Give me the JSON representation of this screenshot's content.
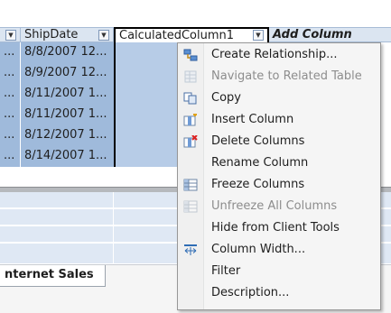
{
  "grid": {
    "headers": {
      "ship_date": "ShipDate",
      "calculated": "CalculatedColumn1",
      "add_column": "Add Column",
      "dropdown_glyph": "▼"
    },
    "left_cell_text": "...",
    "rows": [
      {
        "ship_date": "8/8/2007 12..."
      },
      {
        "ship_date": "8/9/2007 12..."
      },
      {
        "ship_date": "8/11/2007 1..."
      },
      {
        "ship_date": "8/11/2007 1..."
      },
      {
        "ship_date": "8/12/2007 1..."
      },
      {
        "ship_date": "8/14/2007 1..."
      }
    ]
  },
  "sheet_tab": {
    "label": "nternet Sales"
  },
  "context_menu": {
    "items": [
      {
        "label": "Create Relationship...",
        "icon": "relationship-icon",
        "disabled": false
      },
      {
        "label": "Navigate to Related Table",
        "icon": "related-table-icon",
        "disabled": true
      },
      {
        "label": "Copy",
        "icon": "copy-icon",
        "disabled": false
      },
      {
        "label": "Insert Column",
        "icon": "insert-column-icon",
        "disabled": false
      },
      {
        "label": "Delete Columns",
        "icon": "delete-columns-icon",
        "disabled": false
      },
      {
        "label": "Rename Column",
        "icon": "",
        "disabled": false
      },
      {
        "label": "Freeze Columns",
        "icon": "freeze-columns-icon",
        "disabled": false
      },
      {
        "label": "Unfreeze All Columns",
        "icon": "unfreeze-columns-icon",
        "disabled": true
      },
      {
        "label": "Hide from Client Tools",
        "icon": "",
        "disabled": false
      },
      {
        "label": "Column Width...",
        "icon": "column-width-icon",
        "disabled": false
      },
      {
        "label": "Filter",
        "icon": "",
        "disabled": false
      },
      {
        "label": "Description...",
        "icon": "",
        "disabled": false
      }
    ]
  },
  "colors": {
    "header_bg": "#dbe5f1",
    "row_selected": "#9fbadb",
    "column_selected": "#b7cce7",
    "menu_bg": "#f5f5f5",
    "disabled_text": "#8d8d8d"
  }
}
